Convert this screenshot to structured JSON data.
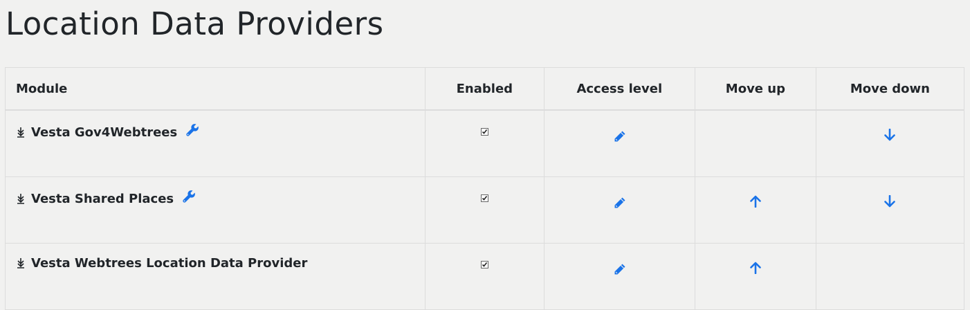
{
  "page": {
    "title": "Location Data Providers"
  },
  "table": {
    "headers": {
      "module": "Module",
      "enabled": "Enabled",
      "access_level": "Access level",
      "move_up": "Move up",
      "move_down": "Move down"
    },
    "rows": [
      {
        "name": "Vesta Gov4Webtrees",
        "enabled": true,
        "has_settings": true,
        "can_move_up": false,
        "can_move_down": true
      },
      {
        "name": "Vesta Shared Places",
        "enabled": true,
        "has_settings": true,
        "can_move_up": true,
        "can_move_down": true
      },
      {
        "name": "Vesta Webtrees Location Data Provider",
        "enabled": true,
        "has_settings": false,
        "can_move_up": true,
        "can_move_down": false
      }
    ]
  },
  "colors": {
    "link": "#1a73e8",
    "text": "#212529",
    "border": "#dcdcdc",
    "background": "#f1f1f0"
  },
  "icons": {
    "expand": "arrows-expand-icon",
    "settings": "wrench-icon",
    "access": "pencil-icon",
    "up": "arrow-up-icon",
    "down": "arrow-down-icon",
    "checkbox": "checkbox-checked"
  }
}
